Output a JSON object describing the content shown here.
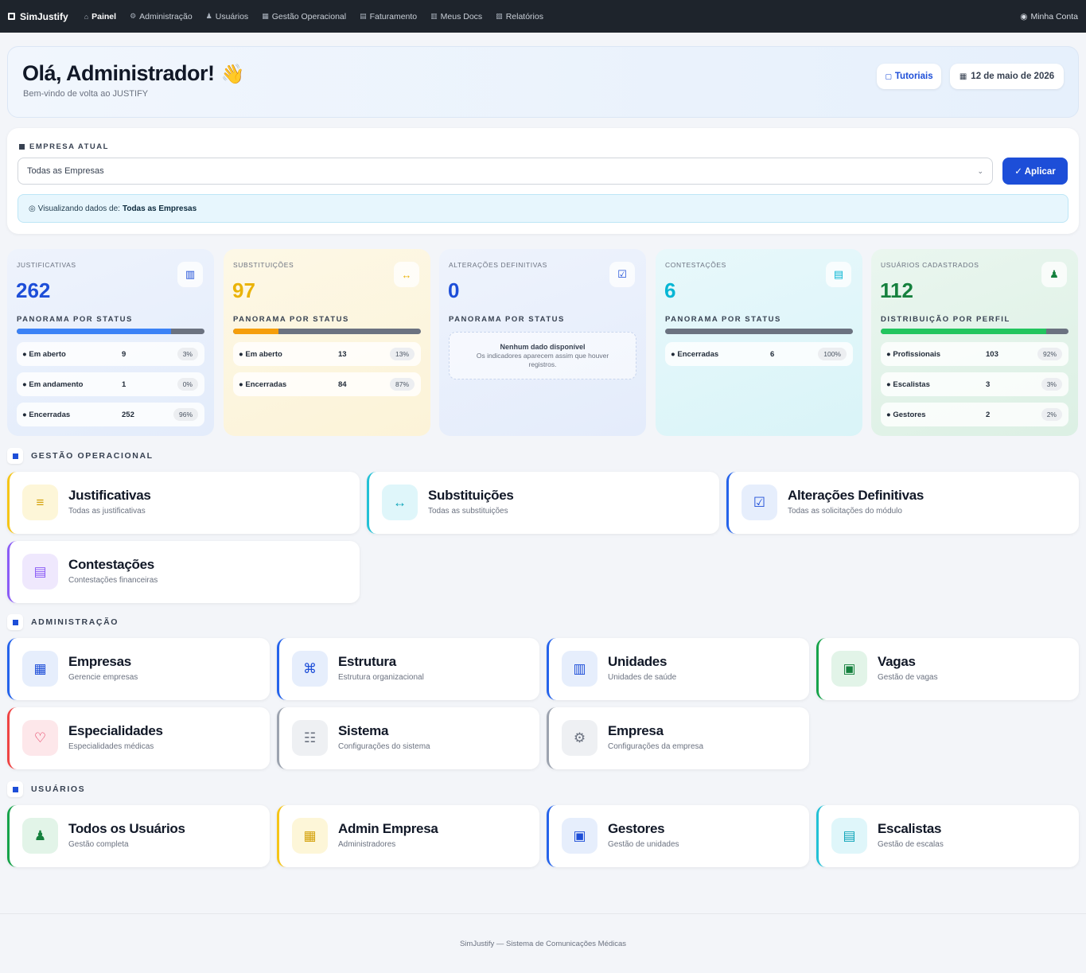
{
  "nav": {
    "brand": "SimJustify",
    "items": [
      {
        "icon": "⌂",
        "label": "Painel",
        "active": true
      },
      {
        "icon": "⚙",
        "label": "Administração"
      },
      {
        "icon": "♟",
        "label": "Usuários"
      },
      {
        "icon": "▦",
        "label": "Gestão Operacional"
      },
      {
        "icon": "▤",
        "label": "Faturamento"
      },
      {
        "icon": "▥",
        "label": "Meus Docs"
      },
      {
        "icon": "▧",
        "label": "Relatórios"
      }
    ],
    "account_label": "Minha Conta"
  },
  "hero": {
    "greeting": "Olá, Administrador!",
    "wave": "👋",
    "subtitle": "Bem-vindo de volta ao JUSTIFY",
    "tutorials_label": "Tutoriais",
    "date_label": "12 de maio de 2026"
  },
  "empresa": {
    "label": "EMPRESA ATUAL",
    "selected": "Todas as Empresas",
    "apply_label": "✓ Aplicar",
    "info_prefix": "Visualizando dados de:",
    "info_value": "Todas as Empresas"
  },
  "stats": [
    {
      "title": "JUSTIFICATIVAS",
      "value": "262",
      "color": "#1d4ed8",
      "icon": "▥",
      "panel_title": "PANORAMA POR STATUS",
      "bar_fill": 0.82,
      "bar_color": "#3b82f6",
      "bg": "linear-gradient(160deg,#eef3fc,#e3ecfb)",
      "rows": [
        {
          "label": "● Em aberto",
          "value": "9",
          "pct": "3%"
        },
        {
          "label": "● Em andamento",
          "value": "1",
          "pct": "0%"
        },
        {
          "label": "● Encerradas",
          "value": "252",
          "pct": "96%"
        }
      ]
    },
    {
      "title": "SUBSTITUIÇÕES",
      "value": "97",
      "color": "#eab308",
      "icon": "↔",
      "panel_title": "PANORAMA POR STATUS",
      "bar_fill": 0.24,
      "bar_color": "#f59e0b",
      "bg": "linear-gradient(160deg,#fdf8e6,#fcf3d8)",
      "rows": [
        {
          "label": "● Em aberto",
          "value": "13",
          "pct": "13%"
        },
        {
          "label": "● Encerradas",
          "value": "84",
          "pct": "87%"
        }
      ]
    },
    {
      "title": "ALTERAÇÕES DEFINITIVAS",
      "value": "0",
      "color": "#1d4ed8",
      "icon": "☑",
      "panel_title": "PANORAMA POR STATUS",
      "bar_fill": 0,
      "bar_color": "#3b82f6",
      "bg": "linear-gradient(160deg,#eef3fc,#e4ecfb)",
      "empty_title": "Nenhum dado disponível",
      "empty_text": "Os indicadores aparecem assim que houver registros.",
      "rows": []
    },
    {
      "title": "CONTESTAÇÕES",
      "value": "6",
      "color": "#06b6d4",
      "icon": "▤",
      "panel_title": "PANORAMA POR STATUS",
      "bar_fill": 0,
      "bar_color": "#06b6d4",
      "bg": "linear-gradient(160deg,#e8f8fb,#d9f4f8)",
      "rows": [
        {
          "label": "● Encerradas",
          "value": "6",
          "pct": "100%"
        }
      ]
    },
    {
      "title": "USUÁRIOS CADASTRADOS",
      "value": "112",
      "color": "#15803d",
      "icon": "♟",
      "panel_title": "DISTRIBUIÇÃO POR PERFIL",
      "bar_fill": 0.88,
      "bar_color": "#22c55e",
      "bg": "linear-gradient(160deg,#eaf6ef,#dcf0e4)",
      "rows": [
        {
          "label": "● Profissionais",
          "value": "103",
          "pct": "92%"
        },
        {
          "label": "● Escalistas",
          "value": "3",
          "pct": "3%"
        },
        {
          "label": "● Gestores",
          "value": "2",
          "pct": "2%"
        }
      ]
    }
  ],
  "sections": {
    "gestao": {
      "title": "GESTÃO OPERACIONAL",
      "cards": [
        {
          "title": "Justificativas",
          "subtitle": "Todas as justificativas",
          "icon": "≡",
          "accent": "#f5c518",
          "icon_bg": "#fdf6d8",
          "icon_color": "#d4a10a"
        },
        {
          "title": "Substituições",
          "subtitle": "Todas as substituições",
          "icon": "↔",
          "accent": "#22c1d6",
          "icon_bg": "#dff6fa",
          "icon_color": "#0ea5b9"
        },
        {
          "title": "Alterações Definitivas",
          "subtitle": "Todas as solicitações do módulo",
          "icon": "☑",
          "accent": "#2563eb",
          "icon_bg": "#e6eefc",
          "icon_color": "#1d4ed8"
        },
        {
          "title": "Contestações",
          "subtitle": "Contestações financeiras",
          "icon": "▤",
          "accent": "#8b5cf6",
          "icon_bg": "#efe8fd",
          "icon_color": "#8b5cf6"
        }
      ]
    },
    "admin": {
      "title": "ADMINISTRAÇÃO",
      "cards": [
        {
          "title": "Empresas",
          "subtitle": "Gerencie empresas",
          "icon": "▦",
          "accent": "#2563eb",
          "icon_bg": "#e6eefc",
          "icon_color": "#1d4ed8"
        },
        {
          "title": "Estrutura",
          "subtitle": "Estrutura organizacional",
          "icon": "⌘",
          "accent": "#2563eb",
          "icon_bg": "#e6eefc",
          "icon_color": "#1d4ed8"
        },
        {
          "title": "Unidades",
          "subtitle": "Unidades de saúde",
          "icon": "▥",
          "accent": "#2563eb",
          "icon_bg": "#e6eefc",
          "icon_color": "#1d4ed8"
        },
        {
          "title": "Vagas",
          "subtitle": "Gestão de vagas",
          "icon": "▣",
          "accent": "#16a34a",
          "icon_bg": "#e2f4e8",
          "icon_color": "#15803d"
        },
        {
          "title": "Especialidades",
          "subtitle": "Especialidades médicas",
          "icon": "♡",
          "accent": "#ef4444",
          "icon_bg": "#fde7ea",
          "icon_color": "#e11d48"
        },
        {
          "title": "Sistema",
          "subtitle": "Configurações do sistema",
          "icon": "☷",
          "accent": "#9ca3af",
          "icon_bg": "#eef0f3",
          "icon_color": "#6b7280"
        },
        {
          "title": "Empresa",
          "subtitle": "Configurações da empresa",
          "icon": "⚙",
          "accent": "#9ca3af",
          "icon_bg": "#eef0f3",
          "icon_color": "#6b7280"
        }
      ]
    },
    "usuarios": {
      "title": "USUÁRIOS",
      "cards": [
        {
          "title": "Todos os Usuários",
          "subtitle": "Gestão completa",
          "icon": "♟",
          "accent": "#16a34a",
          "icon_bg": "#e2f4e8",
          "icon_color": "#15803d"
        },
        {
          "title": "Admin Empresa",
          "subtitle": "Administradores",
          "icon": "▦",
          "accent": "#f5c518",
          "icon_bg": "#fdf6d8",
          "icon_color": "#d4a10a"
        },
        {
          "title": "Gestores",
          "subtitle": "Gestão de unidades",
          "icon": "▣",
          "accent": "#2563eb",
          "icon_bg": "#e6eefc",
          "icon_color": "#1d4ed8"
        },
        {
          "title": "Escalistas",
          "subtitle": "Gestão de escalas",
          "icon": "▤",
          "accent": "#22c1d6",
          "icon_bg": "#dff6fa",
          "icon_color": "#0ea5b9"
        }
      ]
    }
  },
  "footer": "SimJustify — Sistema de Comunicações Médicas"
}
